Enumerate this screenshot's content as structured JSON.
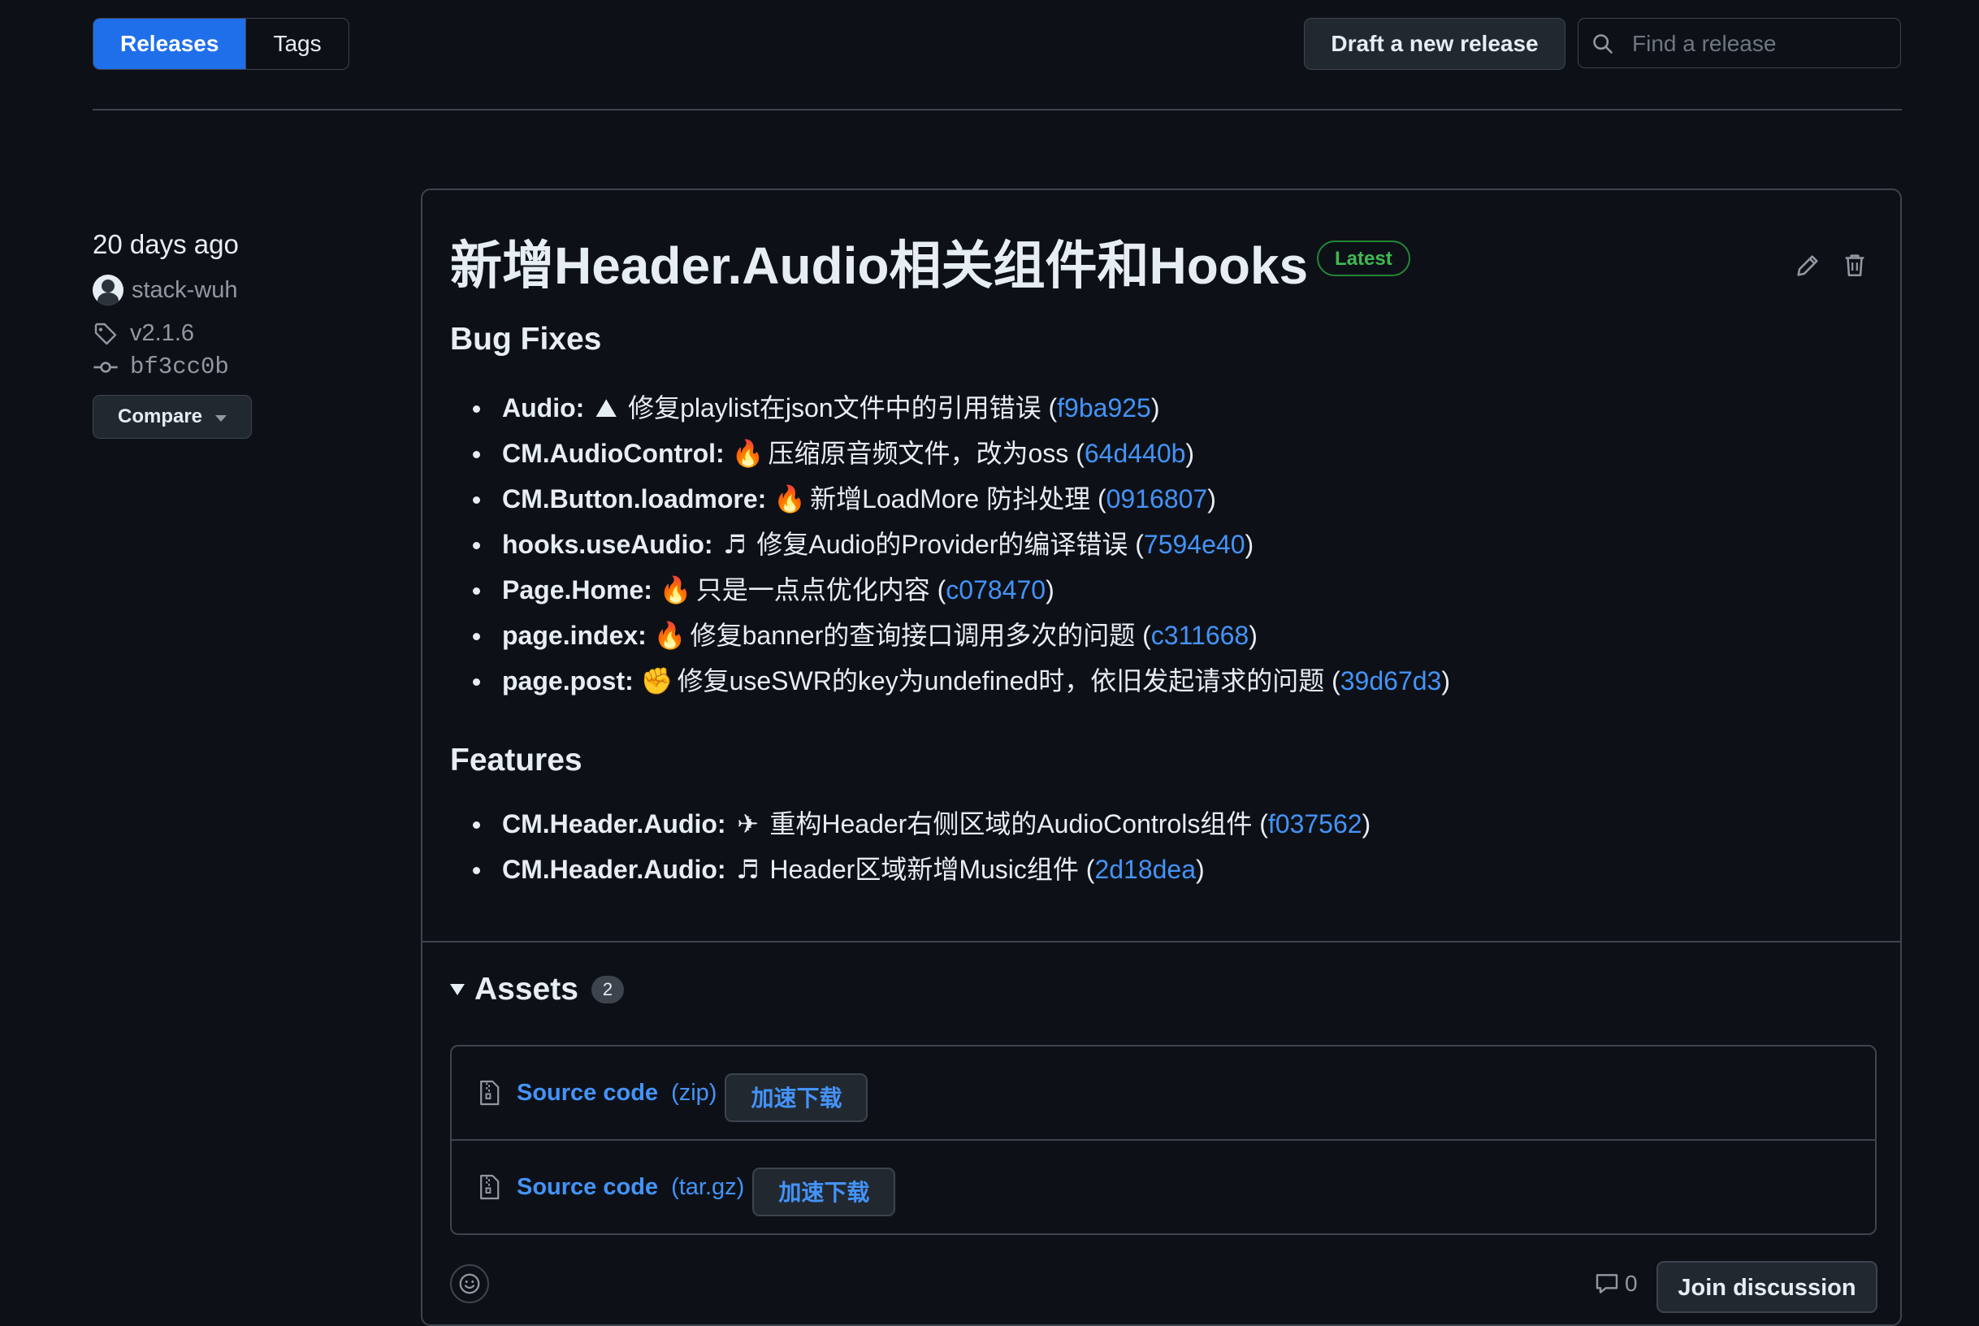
{
  "tabs": {
    "releases": "Releases",
    "tags": "Tags"
  },
  "toolbar": {
    "draft_label": "Draft a new release",
    "search_placeholder": "Find a release"
  },
  "sidebar": {
    "date": "20 days ago",
    "author": "stack-wuh",
    "tag": "v2.1.6",
    "commit": "bf3cc0b",
    "compare_label": "Compare"
  },
  "release": {
    "title": "新增Header.Audio相关组件和Hooks",
    "latest_badge": "Latest",
    "sections": [
      {
        "heading": "Bug Fixes",
        "items": [
          {
            "scope": "Audio:",
            "emoji": "⛰",
            "text": "修复playlist在json文件中的引用错误",
            "hash": "f9ba925"
          },
          {
            "scope": "CM.AudioControl:",
            "emoji": "🔥",
            "text": "压缩原音频文件，改为oss",
            "hash": "64d440b"
          },
          {
            "scope": "CM.Button.loadmore:",
            "emoji": "🔥",
            "text": "新增LoadMore 防抖处理",
            "hash": "0916807"
          },
          {
            "scope": "hooks.useAudio:",
            "emoji": "♬",
            "text": "修复Audio的Provider的编译错误",
            "hash": "7594e40"
          },
          {
            "scope": "Page.Home:",
            "emoji": "🔥",
            "text": "只是一点点优化内容",
            "hash": "c078470"
          },
          {
            "scope": "page.index:",
            "emoji": "🔥",
            "text": "修复banner的查询接口调用多次的问题",
            "hash": "c311668"
          },
          {
            "scope": "page.post:",
            "emoji": "✊",
            "text": "修复useSWR的key为undefined时，依旧发起请求的问题",
            "hash": "39d67d3"
          }
        ]
      },
      {
        "heading": "Features",
        "items": [
          {
            "scope": "CM.Header.Audio:",
            "emoji": "✈",
            "text": "重构Header右侧区域的AudioControls组件",
            "hash": "f037562"
          },
          {
            "scope": "CM.Header.Audio:",
            "emoji": "♬",
            "text": "Header区域新增Music组件",
            "hash": "2d18dea"
          }
        ]
      }
    ]
  },
  "assets": {
    "heading": "Assets",
    "count": "2",
    "items": [
      {
        "name": "Source code",
        "ext": "(zip)",
        "button": "加速下载"
      },
      {
        "name": "Source code",
        "ext": "(tar.gz)",
        "button": "加速下载"
      }
    ]
  },
  "footer": {
    "comment_count": "0",
    "join_label": "Join discussion"
  },
  "colors": {
    "accent": "#1f6feb",
    "link": "#4493f8",
    "latest": "#3fb950",
    "background": "#0d1117",
    "border": "#3d444d"
  }
}
